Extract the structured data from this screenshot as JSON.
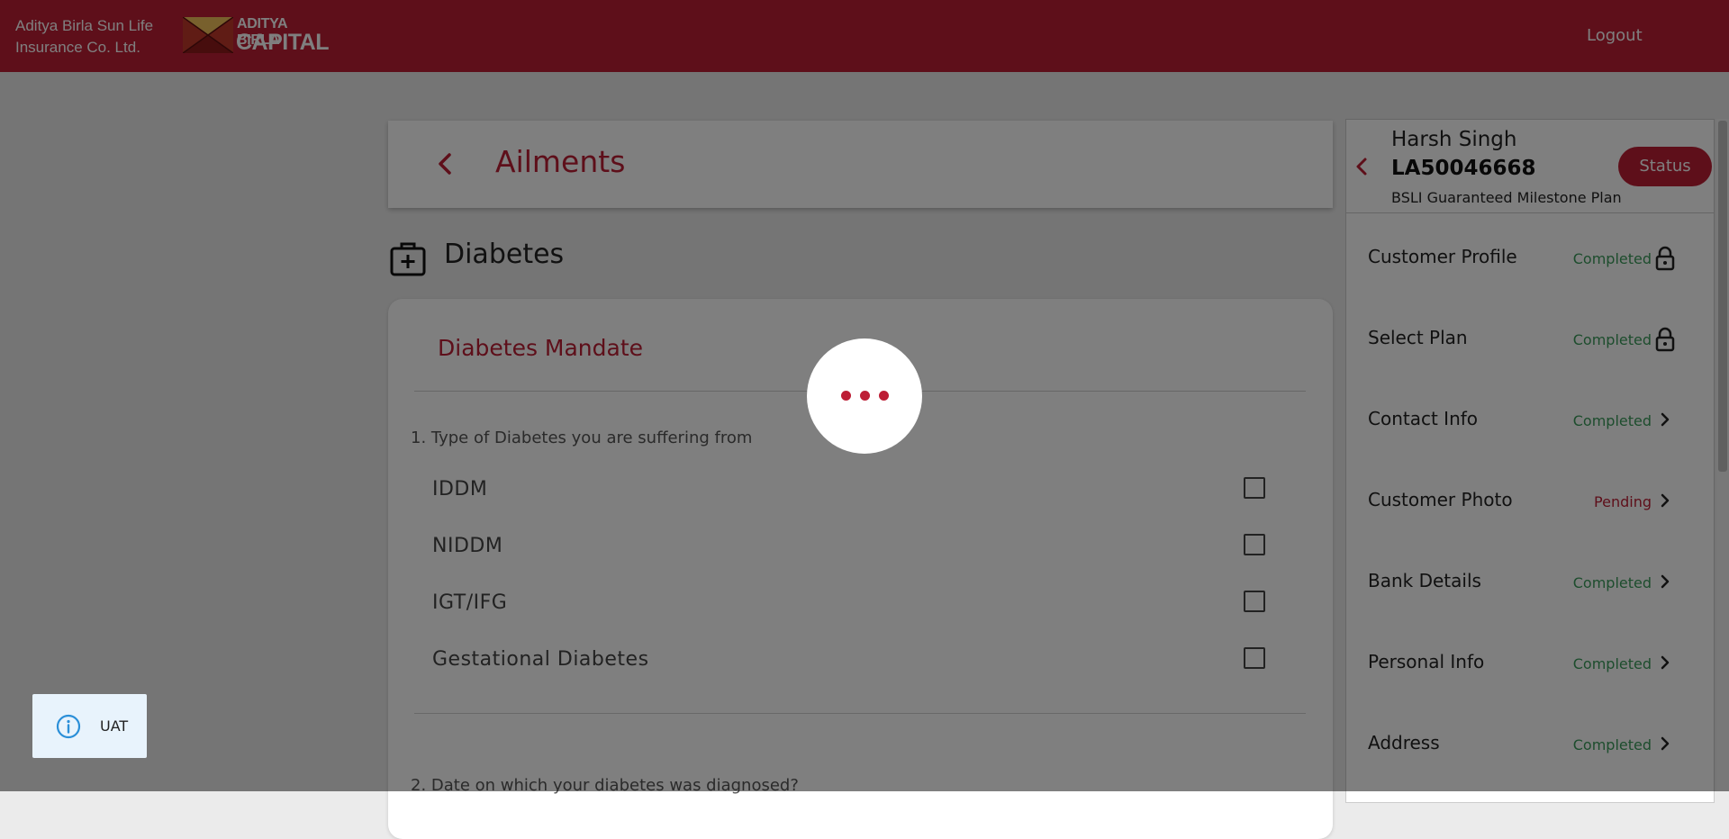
{
  "header": {
    "brand_line1": "Aditya Birla Sun Life",
    "brand_line2": "Insurance Co. Ltd.",
    "logo_line1": "ADITYA BIRLA",
    "logo_line2": "CAPITAL",
    "logout_label": "Logout"
  },
  "page": {
    "title": "Ailments",
    "section_title": "Diabetes",
    "mandate_title": "Diabetes Mandate",
    "question1": "1. Type of Diabetes you are suffering from",
    "options": [
      "IDDM",
      "NIDDM",
      "IGT/IFG",
      "Gestational Diabetes"
    ],
    "question2": "2. Date on which your diabetes was diagnosed?"
  },
  "customer": {
    "name": "Harsh Singh",
    "id": "LA50046668",
    "plan": "BSLI Guaranteed Milestone Plan",
    "status_label": "Status"
  },
  "nav": [
    {
      "label": "Customer Profile",
      "status": "Completed",
      "icon": "lock-icon"
    },
    {
      "label": "Select Plan",
      "status": "Completed",
      "icon": "lock-icon"
    },
    {
      "label": "Contact Info",
      "status": "Completed",
      "icon": "chevron-right-icon"
    },
    {
      "label": "Customer Photo",
      "status": "Pending",
      "icon": "chevron-right-icon"
    },
    {
      "label": "Bank Details",
      "status": "Completed",
      "icon": "chevron-right-icon"
    },
    {
      "label": "Personal Info",
      "status": "Completed",
      "icon": "chevron-right-icon"
    },
    {
      "label": "Address",
      "status": "Completed",
      "icon": "chevron-right-icon"
    }
  ],
  "env_badge": {
    "label": "UAT"
  },
  "colors": {
    "brand": "#bd1e35",
    "completed": "#3a9a5b",
    "pending": "#bd1e35"
  }
}
